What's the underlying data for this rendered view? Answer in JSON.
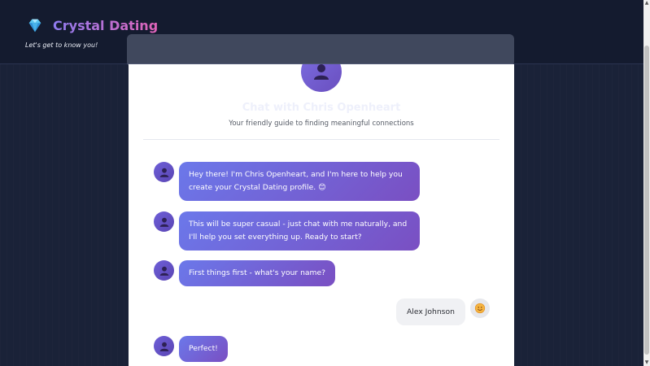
{
  "header": {
    "brand": "Crystal Dating",
    "tagline": "Let's get to know you!"
  },
  "chat": {
    "title": "Chat with Chris Openheart",
    "subtitle": "Your friendly guide to finding meaningful connections",
    "messages": [
      {
        "sender": "bot",
        "text": "Hey there! I'm Chris Openheart, and I'm here to help you create your Crystal Dating profile. 😊"
      },
      {
        "sender": "bot",
        "text": "This will be super casual - just chat with me naturally, and I'll help you set everything up. Ready to start?"
      },
      {
        "sender": "bot",
        "text": "First things first - what's your name?"
      },
      {
        "sender": "user",
        "text": "Alex Johnson"
      },
      {
        "sender": "bot",
        "text": "Perfect!"
      }
    ]
  },
  "icons": {
    "brand": "diamond-icon",
    "bot": "person-icon",
    "user": "smiley-icon"
  },
  "colors": {
    "brand_gradient_start": "#8f7cf0",
    "brand_gradient_end": "#e164b8",
    "bubble": "#6b78ea"
  }
}
